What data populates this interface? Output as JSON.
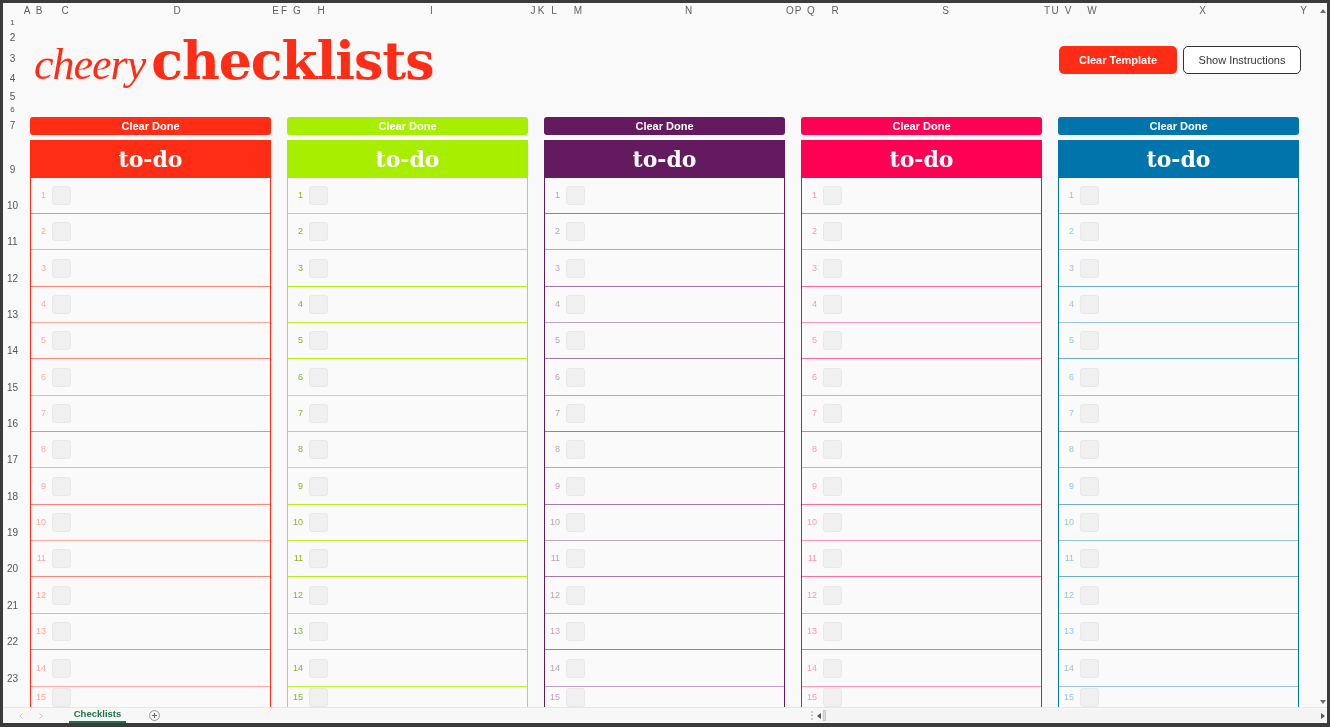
{
  "spreadsheet": {
    "column_headers": [
      "A",
      "B",
      "C",
      "D",
      "E",
      "F",
      "G",
      "H",
      "I",
      "J",
      "K",
      "L",
      "M",
      "N",
      "O",
      "P",
      "Q",
      "R",
      "S",
      "T",
      "U",
      "V",
      "W",
      "X",
      "Y"
    ],
    "row_headers": [
      "1",
      "2",
      "3",
      "4",
      "5",
      "6",
      "7",
      "9",
      "10",
      "11",
      "12",
      "13",
      "14",
      "15",
      "16",
      "17",
      "18",
      "19",
      "20",
      "21",
      "22",
      "23"
    ]
  },
  "title": {
    "script_word": "cheery",
    "bold_word": "checklists"
  },
  "buttons": [
    {
      "label": "Clear Template",
      "kind": "filled"
    },
    {
      "label": "Show Instructions",
      "kind": "outlined"
    }
  ],
  "checklists": [
    {
      "color": "#ff2d16",
      "clear_button": "Clear Done",
      "heading": "to-do",
      "items": [
        {
          "number": "1",
          "checked": false
        },
        {
          "number": "2",
          "checked": false
        },
        {
          "number": "3",
          "checked": false
        },
        {
          "number": "4",
          "checked": false
        },
        {
          "number": "5",
          "checked": false
        },
        {
          "number": "6",
          "checked": false
        },
        {
          "number": "7",
          "checked": false
        },
        {
          "number": "8",
          "checked": false
        },
        {
          "number": "9",
          "checked": false
        },
        {
          "number": "10",
          "checked": false
        },
        {
          "number": "11",
          "checked": false
        },
        {
          "number": "12",
          "checked": false
        },
        {
          "number": "13",
          "checked": false
        },
        {
          "number": "14",
          "checked": false
        },
        {
          "number": "15",
          "checked": false
        }
      ]
    },
    {
      "color": "#a8ee00",
      "clear_button": "Clear Done",
      "heading": "to-do",
      "items": [
        {
          "number": "1",
          "checked": false
        },
        {
          "number": "2",
          "checked": false
        },
        {
          "number": "3",
          "checked": false
        },
        {
          "number": "4",
          "checked": false
        },
        {
          "number": "5",
          "checked": false
        },
        {
          "number": "6",
          "checked": false
        },
        {
          "number": "7",
          "checked": false
        },
        {
          "number": "8",
          "checked": false
        },
        {
          "number": "9",
          "checked": false
        },
        {
          "number": "10",
          "checked": false
        },
        {
          "number": "11",
          "checked": false
        },
        {
          "number": "12",
          "checked": false
        },
        {
          "number": "13",
          "checked": false
        },
        {
          "number": "14",
          "checked": false
        },
        {
          "number": "15",
          "checked": false
        }
      ]
    },
    {
      "color": "#641a5f",
      "clear_button": "Clear Done",
      "heading": "to-do",
      "items": [
        {
          "number": "1",
          "checked": false
        },
        {
          "number": "2",
          "checked": false
        },
        {
          "number": "3",
          "checked": false
        },
        {
          "number": "4",
          "checked": false
        },
        {
          "number": "5",
          "checked": false
        },
        {
          "number": "6",
          "checked": false
        },
        {
          "number": "7",
          "checked": false
        },
        {
          "number": "8",
          "checked": false
        },
        {
          "number": "9",
          "checked": false
        },
        {
          "number": "10",
          "checked": false
        },
        {
          "number": "11",
          "checked": false
        },
        {
          "number": "12",
          "checked": false
        },
        {
          "number": "13",
          "checked": false
        },
        {
          "number": "14",
          "checked": false
        },
        {
          "number": "15",
          "checked": false
        }
      ]
    },
    {
      "color": "#ff0055",
      "clear_button": "Clear Done",
      "heading": "to-do",
      "items": [
        {
          "number": "1",
          "checked": false
        },
        {
          "number": "2",
          "checked": false
        },
        {
          "number": "3",
          "checked": false
        },
        {
          "number": "4",
          "checked": false
        },
        {
          "number": "5",
          "checked": false
        },
        {
          "number": "6",
          "checked": false
        },
        {
          "number": "7",
          "checked": false
        },
        {
          "number": "8",
          "checked": false
        },
        {
          "number": "9",
          "checked": false
        },
        {
          "number": "10",
          "checked": false
        },
        {
          "number": "11",
          "checked": false
        },
        {
          "number": "12",
          "checked": false
        },
        {
          "number": "13",
          "checked": false
        },
        {
          "number": "14",
          "checked": false
        },
        {
          "number": "15",
          "checked": false
        }
      ]
    },
    {
      "color": "#0074ab",
      "clear_button": "Clear Done",
      "heading": "to-do",
      "items": [
        {
          "number": "1",
          "checked": false
        },
        {
          "number": "2",
          "checked": false
        },
        {
          "number": "3",
          "checked": false
        },
        {
          "number": "4",
          "checked": false
        },
        {
          "number": "5",
          "checked": false
        },
        {
          "number": "6",
          "checked": false
        },
        {
          "number": "7",
          "checked": false
        },
        {
          "number": "8",
          "checked": false
        },
        {
          "number": "9",
          "checked": false
        },
        {
          "number": "10",
          "checked": false
        },
        {
          "number": "11",
          "checked": false
        },
        {
          "number": "12",
          "checked": false
        },
        {
          "number": "13",
          "checked": false
        },
        {
          "number": "14",
          "checked": false
        },
        {
          "number": "15",
          "checked": false
        }
      ]
    }
  ],
  "sheet_tabs": [
    {
      "label": "Checklists",
      "selected": true
    }
  ]
}
